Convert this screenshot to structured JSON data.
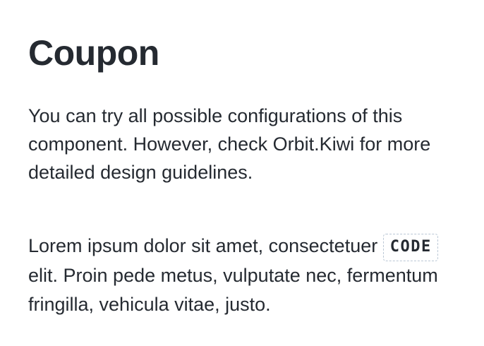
{
  "page": {
    "title": "Coupon",
    "description": "You can try all possible configurations of this component. However, check Orbit.Kiwi for more detailed design guidelines."
  },
  "example": {
    "text_before": "Lorem ipsum dolor sit amet, consectetuer ",
    "coupon_code": "CODE",
    "text_after": " elit. Proin pede metus, vulputate nec, fermentum fringilla, vehicula vitae, justo."
  },
  "colors": {
    "text": "#252a31",
    "coupon_border": "#bac7d5",
    "background": "#ffffff"
  }
}
